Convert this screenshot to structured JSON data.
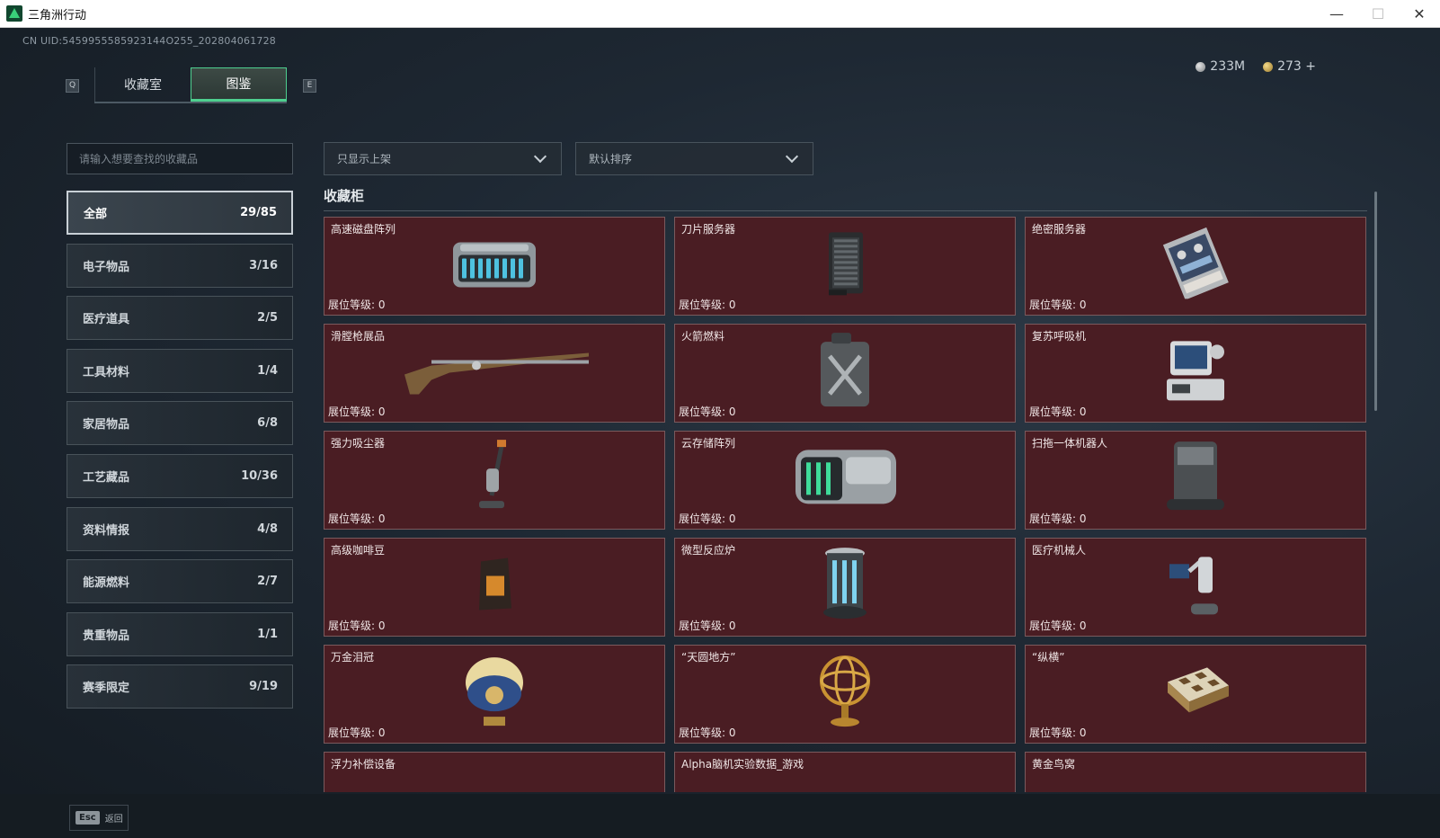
{
  "window": {
    "title": "三角洲行动"
  },
  "uid_text": "CN UID:5459955585923144O255_202804061728",
  "tabs": {
    "q_key": "Q",
    "e_key": "E",
    "items": [
      "收藏室",
      "图鉴"
    ],
    "active_index": 1
  },
  "currency": {
    "silver": "233M",
    "gold": "273 +"
  },
  "search": {
    "placeholder": "请输入想要查找的收藏品"
  },
  "categories": [
    {
      "label": "全部",
      "count": "29/85"
    },
    {
      "label": "电子物品",
      "count": "3/16"
    },
    {
      "label": "医疗道具",
      "count": "2/5"
    },
    {
      "label": "工具材料",
      "count": "1/4"
    },
    {
      "label": "家居物品",
      "count": "6/8"
    },
    {
      "label": "工艺藏品",
      "count": "10/36"
    },
    {
      "label": "资料情报",
      "count": "4/8"
    },
    {
      "label": "能源燃料",
      "count": "2/7"
    },
    {
      "label": "贵重物品",
      "count": "1/1"
    },
    {
      "label": "赛季限定",
      "count": "9/19"
    }
  ],
  "filters": {
    "shelf": "只显示上架",
    "sort": "默认排序"
  },
  "section": {
    "title": "收藏柜"
  },
  "level_label": "展位等级: 0",
  "items": [
    {
      "name": "高速磁盘阵列",
      "icon": "disk-array-icon"
    },
    {
      "name": "刀片服务器",
      "icon": "blade-server-icon"
    },
    {
      "name": "绝密服务器",
      "icon": "secret-server-icon"
    },
    {
      "name": "滑膛枪展品",
      "icon": "musket-icon"
    },
    {
      "name": "火箭燃料",
      "icon": "fuel-can-icon"
    },
    {
      "name": "复苏呼吸机",
      "icon": "ventilator-icon"
    },
    {
      "name": "强力吸尘器",
      "icon": "vacuum-icon"
    },
    {
      "name": "云存储阵列",
      "icon": "cloud-storage-icon"
    },
    {
      "name": "扫拖一体机器人",
      "icon": "robot-vacuum-icon"
    },
    {
      "name": "高级咖啡豆",
      "icon": "coffee-bag-icon"
    },
    {
      "name": "微型反应炉",
      "icon": "reactor-icon"
    },
    {
      "name": "医疗机械人",
      "icon": "medical-robot-icon"
    },
    {
      "name": "万金泪冠",
      "icon": "jeweled-egg-icon"
    },
    {
      "name": "“天圆地方”",
      "icon": "armillary-sphere-icon"
    },
    {
      "name": "“纵横”",
      "icon": "chess-box-icon"
    },
    {
      "name": "浮力补偿设备",
      "icon": "buoyancy-device-icon"
    },
    {
      "name": "Alpha脑机实验数据_游戏",
      "icon": "brain-data-icon"
    },
    {
      "name": "黄金鸟窝",
      "icon": "golden-nest-icon"
    }
  ],
  "bottom": {
    "esc_key": "Esc",
    "back_label": "返回"
  }
}
